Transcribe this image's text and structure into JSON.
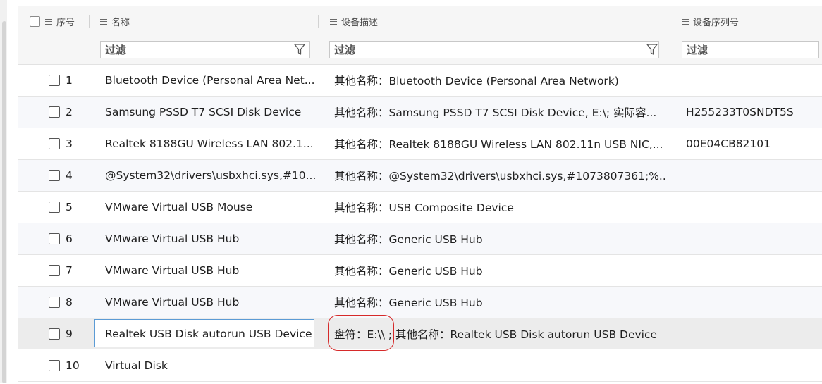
{
  "header": {
    "col_index": "序号",
    "col_name": "名称",
    "col_desc": "设备描述",
    "col_serial": "设备序列号"
  },
  "filter": {
    "name_placeholder": "过滤",
    "desc_placeholder": "过滤",
    "serial_placeholder": "过滤"
  },
  "rows": [
    {
      "index": "1",
      "name": "Bluetooth Device (Personal Area Net...",
      "desc": "其他名称：Bluetooth Device (Personal Area Network)",
      "serial": ""
    },
    {
      "index": "2",
      "name": "Samsung PSSD T7 SCSI Disk Device",
      "desc": "其他名称：Samsung PSSD T7 SCSI Disk Device, E:\\; 实际容...",
      "serial": "H255233T0SNDT5S"
    },
    {
      "index": "3",
      "name": "Realtek 8188GU Wireless LAN 802.1...",
      "desc": "其他名称：Realtek 8188GU Wireless LAN 802.11n USB NIC,...",
      "serial": "00E04CB82101"
    },
    {
      "index": "4",
      "name": "@System32\\drivers\\usbxhci.sys,#10...",
      "desc": "其他名称：@System32\\drivers\\usbxhci.sys,#1073807361;%...",
      "serial": ""
    },
    {
      "index": "5",
      "name": "VMware Virtual USB Mouse",
      "desc": "其他名称：USB Composite Device",
      "serial": ""
    },
    {
      "index": "6",
      "name": "VMware Virtual USB Hub",
      "desc": "其他名称：Generic USB Hub",
      "serial": ""
    },
    {
      "index": "7",
      "name": "VMware Virtual USB Hub",
      "desc": "其他名称：Generic USB Hub",
      "serial": ""
    },
    {
      "index": "8",
      "name": "VMware Virtual USB Hub",
      "desc": "其他名称：Generic USB Hub",
      "serial": ""
    },
    {
      "index": "9",
      "name": "Realtek USB Disk autorun USB Device",
      "desc": "盘符：E:\\\\ ; 其他名称：Realtek USB Disk autorun USB Device",
      "serial": ""
    },
    {
      "index": "10",
      "name": "Virtual Disk",
      "desc": "",
      "serial": ""
    }
  ],
  "colors": {
    "selection_border": "#8f96c9",
    "active_cell_border": "#5b9bd5",
    "callout": "#d62a2a"
  }
}
